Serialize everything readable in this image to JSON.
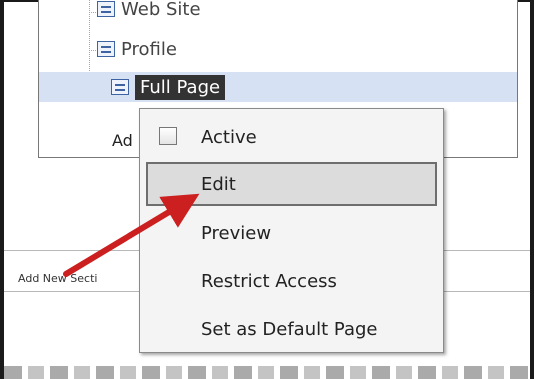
{
  "tree": {
    "items": [
      {
        "label": "Web Site"
      },
      {
        "label": "Profile"
      },
      {
        "label": "Full Page"
      }
    ],
    "partial_link": "Ad"
  },
  "section": {
    "label": "Add New Secti"
  },
  "context_menu": {
    "items": [
      {
        "label": "Active",
        "checked": false
      },
      {
        "label": "Edit",
        "hovered": true
      },
      {
        "label": "Preview"
      },
      {
        "label": "Restrict Access"
      },
      {
        "label": "Set as Default Page"
      }
    ]
  },
  "annotation": {
    "arrow_color": "#cc1f1f"
  },
  "colors": {
    "selection": "#d6e1f4",
    "menu_bg": "#f4f4f4"
  }
}
